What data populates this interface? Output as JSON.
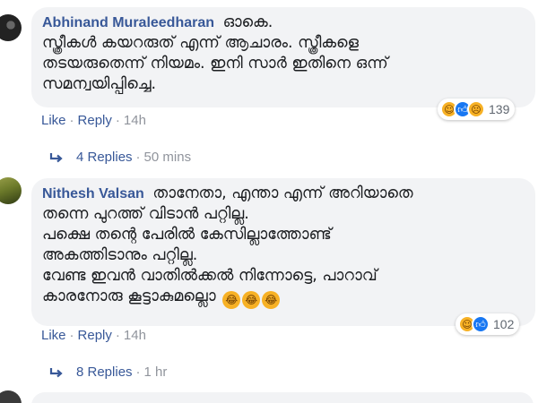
{
  "comments": [
    {
      "author": "Abhinand Muraleedharan",
      "text": "ഓകെ.\nസ്ത്രീകൾ കയറരുത് എന്ന് ആചാരം. സ്ത്രീകളെ\nതടയരുതെന്ന് നിയമം. ഇനി സാർ ഇതിനെ ഒന്ന്\nസമന്വയിപ്പിച്ചെ.",
      "like_label": "Like",
      "reply_label": "Reply",
      "time": "14h",
      "reaction_icons": [
        "haha",
        "like",
        "sad"
      ],
      "reaction_count": "139",
      "replies_label": "4 Replies",
      "replies_time": "50 mins"
    },
    {
      "author": "Nithesh Valsan",
      "text": "താനേതാ, എന്താ എന്ന് അറിയാതെ\nതന്നെ പുറത്ത് വിടാൻ പറ്റില്ല.\nപക്ഷെ തന്റെ പേരിൽ കേസില്ലാത്തോണ്ട്\nഅകത്തിടാനും പറ്റില്ല.\nവേണ്ട ഇവൻ വാതിൽക്കൽ നിന്നോട്ടെ, പാറാവ്\nകാരനോരു കൂട്ടാകുമല്ലൊ",
      "inline_emojis": [
        "😂",
        "😂",
        "😂"
      ],
      "like_label": "Like",
      "reply_label": "Reply",
      "time": "14h",
      "reaction_icons": [
        "haha",
        "like"
      ],
      "reaction_count": "102",
      "replies_label": "8 Replies",
      "replies_time": "1 hr"
    }
  ],
  "separator": "·",
  "colors": {
    "link": "#385898",
    "muted": "#90949c",
    "bubble": "#f2f3f5",
    "like_blue": "#1877f2",
    "emoji_yellow": "#f7b125"
  }
}
